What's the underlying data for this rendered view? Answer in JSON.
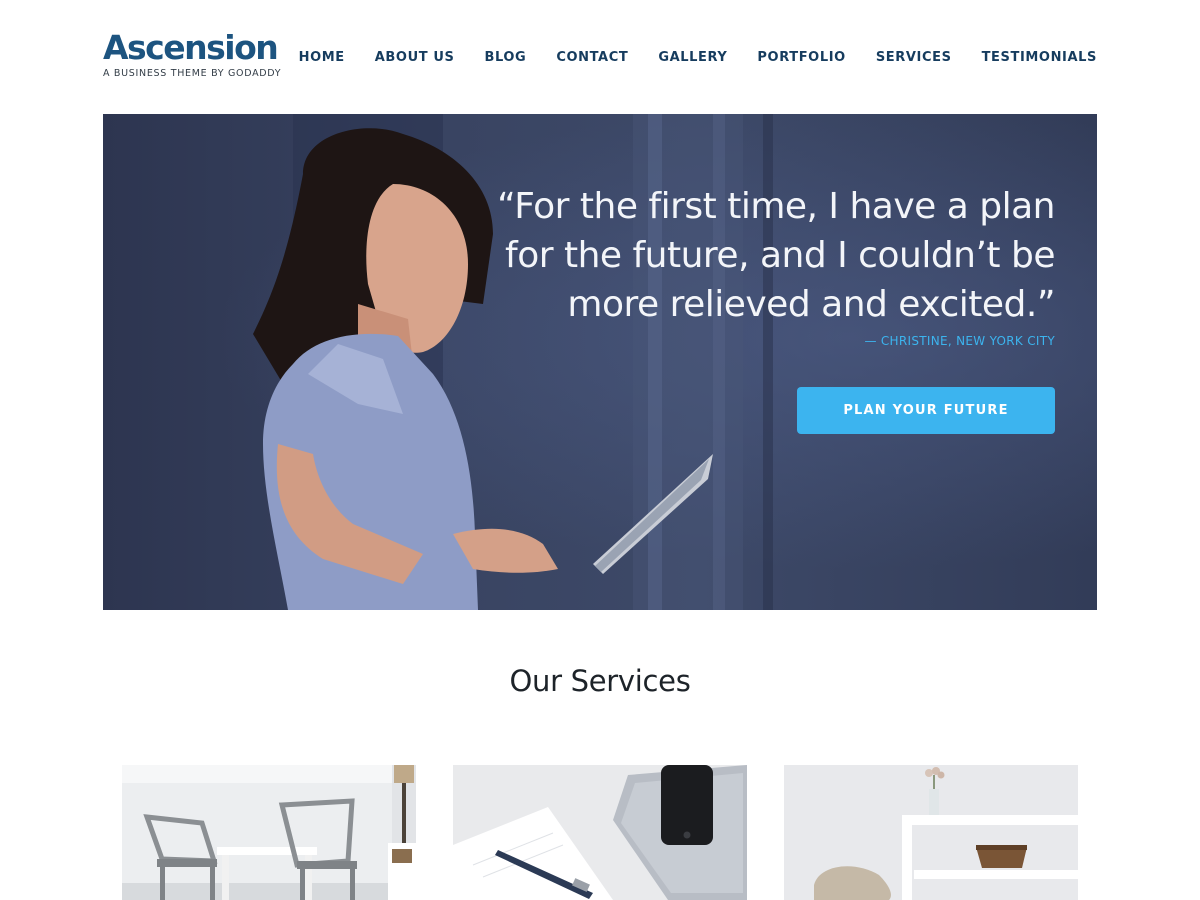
{
  "site": {
    "title": "Ascension",
    "tagline": "A BUSINESS THEME BY GODADDY"
  },
  "nav": {
    "items": [
      {
        "label": "HOME"
      },
      {
        "label": "ABOUT US"
      },
      {
        "label": "BLOG"
      },
      {
        "label": "CONTACT"
      },
      {
        "label": "GALLERY"
      },
      {
        "label": "PORTFOLIO"
      },
      {
        "label": "SERVICES"
      },
      {
        "label": "TESTIMONIALS"
      }
    ]
  },
  "hero": {
    "quote_lines": [
      "“For the first time, I have a plan",
      "for the future, and I couldn’t be",
      "more relieved and excited.”"
    ],
    "attribution": "— CHRISTINE, NEW YORK CITY",
    "cta_label": "PLAN YOUR FUTURE"
  },
  "services": {
    "title": "Our Services"
  },
  "colors": {
    "brand": "#1d5480",
    "nav_text": "#163c5e",
    "accent": "#3cb4ef"
  }
}
